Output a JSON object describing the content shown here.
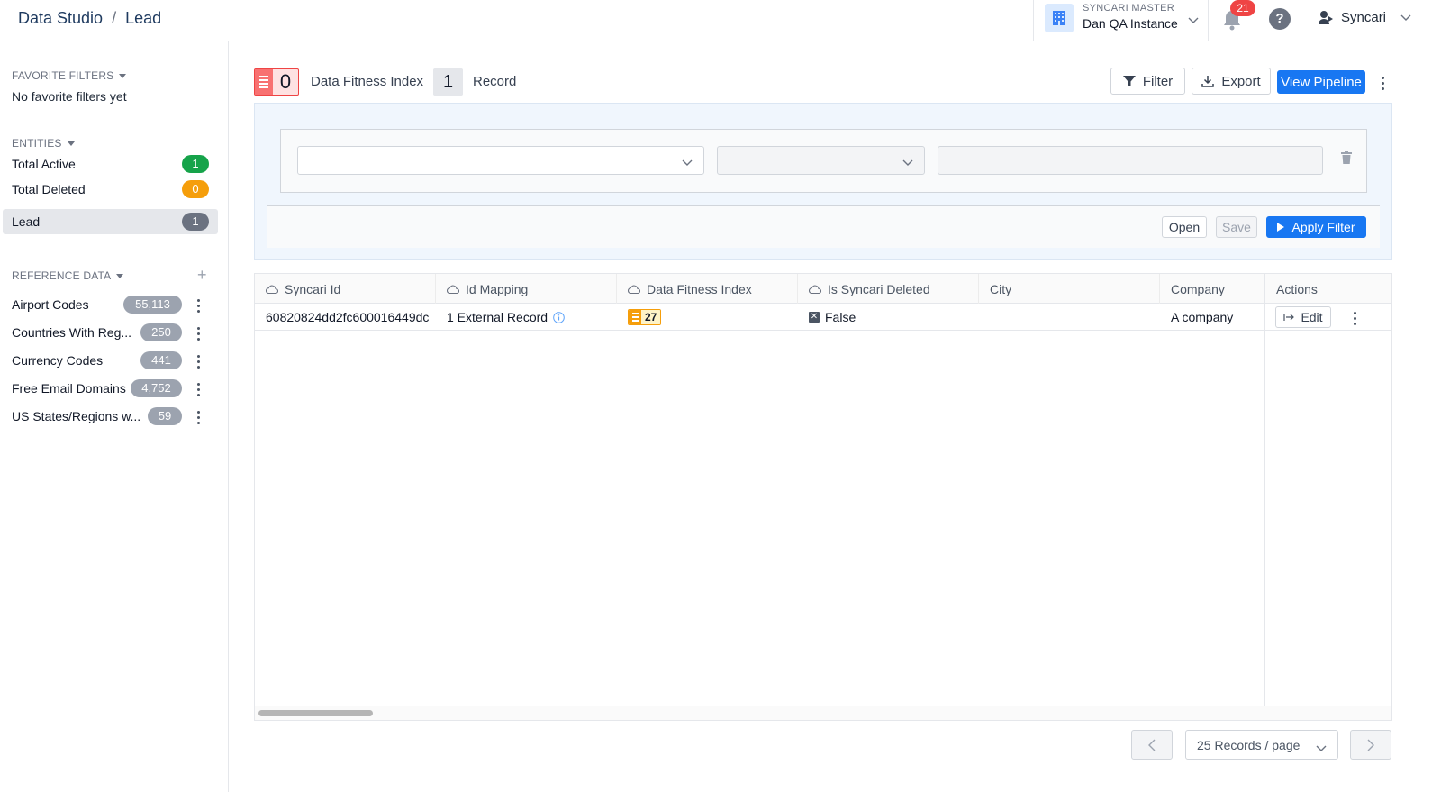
{
  "breadcrumb": {
    "root": "Data Studio",
    "separator": "/",
    "current": "Lead"
  },
  "instance": {
    "label": "SYNCARI MASTER",
    "name": "Dan QA Instance"
  },
  "notifications": {
    "count": "21"
  },
  "help": {
    "glyph": "?"
  },
  "user": {
    "name": "Syncari"
  },
  "sidebar": {
    "favorite_filters": {
      "title": "FAVORITE FILTERS",
      "empty_text": "No favorite filters yet"
    },
    "entities": {
      "title": "ENTITIES",
      "items": [
        {
          "label": "Total Active",
          "count": "1",
          "color": "#16a34a"
        },
        {
          "label": "Total Deleted",
          "count": "0",
          "color": "#f59e0b"
        },
        {
          "label": "Lead",
          "count": "1",
          "color": "#6b7280"
        }
      ]
    },
    "reference_data": {
      "title": "REFERENCE DATA",
      "add_glyph": "+",
      "items": [
        {
          "label": "Airport Codes",
          "count": "55,113"
        },
        {
          "label": "Countries With Reg...",
          "count": "250"
        },
        {
          "label": "Currency Codes",
          "count": "441"
        },
        {
          "label": "Free Email Domains",
          "count": "4,752"
        },
        {
          "label": "US States/Regions w...",
          "count": "59"
        }
      ]
    }
  },
  "toolbar": {
    "dfi_value": "0",
    "dfi_label": "Data Fitness Index",
    "record_count": "1",
    "record_label": "Record",
    "filter_label": "Filter",
    "export_label": "Export",
    "view_pipeline_label": "View Pipeline"
  },
  "filter_panel": {
    "open_label": "Open",
    "save_label": "Save",
    "apply_label": "Apply Filter"
  },
  "table": {
    "columns": [
      "Syncari Id",
      "Id Mapping",
      "Data Fitness Index",
      "Is Syncari Deleted",
      "City",
      "Company",
      "Actions"
    ],
    "rows": [
      {
        "syncari_id": "60820824dd2fc600016449dc",
        "id_mapping": "1 External Record",
        "dfi": "27",
        "is_deleted": "False",
        "city": "",
        "company": "A company",
        "edit_label": "Edit"
      }
    ]
  },
  "pagination": {
    "page_size_label": "25 Records / page"
  },
  "colors": {
    "accent": "#1877f2",
    "danger": "#ef4444",
    "warning": "#f59e0b",
    "success": "#16a34a"
  }
}
